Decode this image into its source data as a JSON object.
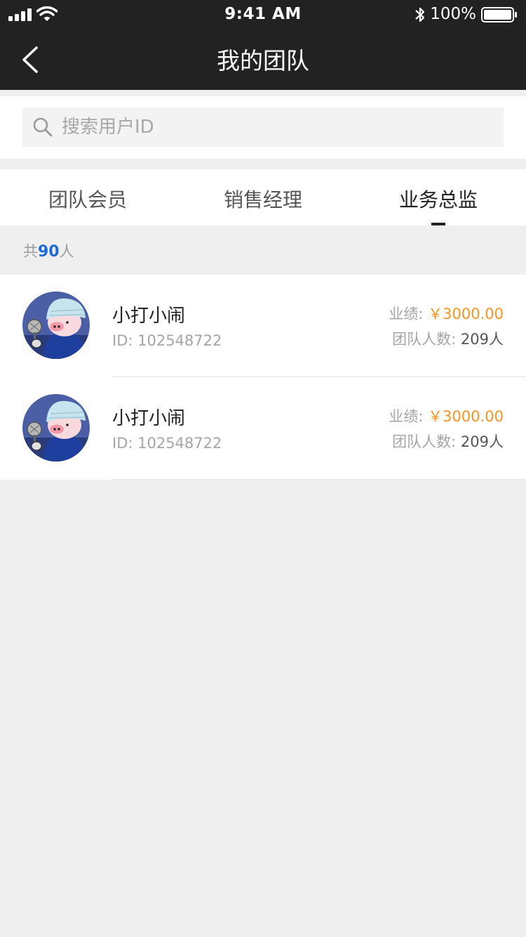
{
  "status_bar": {
    "time": "9:41 AM",
    "battery_percent": "100%",
    "signal_icon": "cellular-signal-icon",
    "wifi_icon": "wifi-icon",
    "bluetooth_icon": "bluetooth-icon",
    "battery_icon": "battery-icon"
  },
  "nav": {
    "title": "我的团队",
    "back_icon": "chevron-left-icon"
  },
  "search": {
    "placeholder": "搜索用户ID",
    "value": "",
    "icon": "search-icon"
  },
  "tabs": [
    {
      "label": "团队会员",
      "active": false
    },
    {
      "label": "销售经理",
      "active": false
    },
    {
      "label": "业务总监",
      "active": true
    }
  ],
  "summary": {
    "prefix": "共",
    "count": "90",
    "suffix": "人"
  },
  "members": [
    {
      "name": "小打小闹",
      "id_text": "ID: 102548722",
      "performance_label": "业绩:",
      "performance_value": "￥3000.00",
      "team_label": "团队人数:",
      "team_value": "209人"
    },
    {
      "name": "小打小闹",
      "id_text": "ID: 102548722",
      "performance_label": "业绩:",
      "performance_value": "￥3000.00",
      "team_label": "团队人数:",
      "team_value": "209人"
    }
  ],
  "colors": {
    "header_bg": "#222222",
    "page_bg": "#efefef",
    "accent_blue": "#1e6ad8",
    "amount_orange": "#f7941d"
  }
}
